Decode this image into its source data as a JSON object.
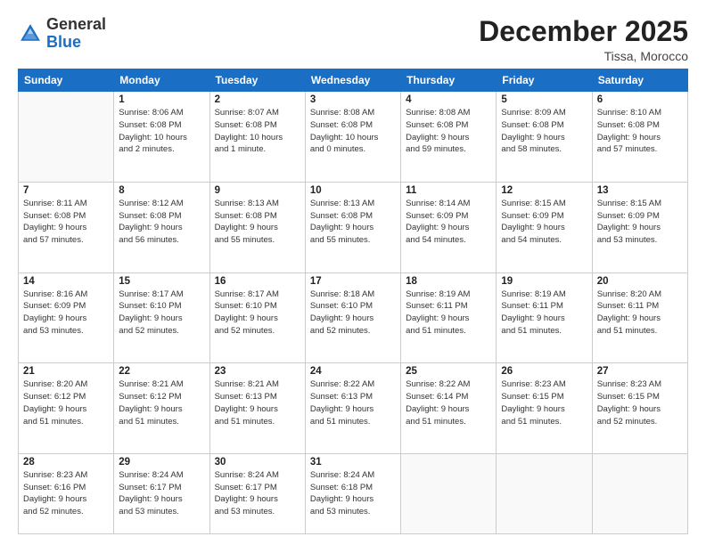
{
  "logo": {
    "general": "General",
    "blue": "Blue"
  },
  "header": {
    "title": "December 2025",
    "subtitle": "Tissa, Morocco"
  },
  "weekdays": [
    "Sunday",
    "Monday",
    "Tuesday",
    "Wednesday",
    "Thursday",
    "Friday",
    "Saturday"
  ],
  "weeks": [
    [
      {
        "day": "",
        "info": ""
      },
      {
        "day": "1",
        "info": "Sunrise: 8:06 AM\nSunset: 6:08 PM\nDaylight: 10 hours\nand 2 minutes."
      },
      {
        "day": "2",
        "info": "Sunrise: 8:07 AM\nSunset: 6:08 PM\nDaylight: 10 hours\nand 1 minute."
      },
      {
        "day": "3",
        "info": "Sunrise: 8:08 AM\nSunset: 6:08 PM\nDaylight: 10 hours\nand 0 minutes."
      },
      {
        "day": "4",
        "info": "Sunrise: 8:08 AM\nSunset: 6:08 PM\nDaylight: 9 hours\nand 59 minutes."
      },
      {
        "day": "5",
        "info": "Sunrise: 8:09 AM\nSunset: 6:08 PM\nDaylight: 9 hours\nand 58 minutes."
      },
      {
        "day": "6",
        "info": "Sunrise: 8:10 AM\nSunset: 6:08 PM\nDaylight: 9 hours\nand 57 minutes."
      }
    ],
    [
      {
        "day": "7",
        "info": "Sunrise: 8:11 AM\nSunset: 6:08 PM\nDaylight: 9 hours\nand 57 minutes."
      },
      {
        "day": "8",
        "info": "Sunrise: 8:12 AM\nSunset: 6:08 PM\nDaylight: 9 hours\nand 56 minutes."
      },
      {
        "day": "9",
        "info": "Sunrise: 8:13 AM\nSunset: 6:08 PM\nDaylight: 9 hours\nand 55 minutes."
      },
      {
        "day": "10",
        "info": "Sunrise: 8:13 AM\nSunset: 6:08 PM\nDaylight: 9 hours\nand 55 minutes."
      },
      {
        "day": "11",
        "info": "Sunrise: 8:14 AM\nSunset: 6:09 PM\nDaylight: 9 hours\nand 54 minutes."
      },
      {
        "day": "12",
        "info": "Sunrise: 8:15 AM\nSunset: 6:09 PM\nDaylight: 9 hours\nand 54 minutes."
      },
      {
        "day": "13",
        "info": "Sunrise: 8:15 AM\nSunset: 6:09 PM\nDaylight: 9 hours\nand 53 minutes."
      }
    ],
    [
      {
        "day": "14",
        "info": "Sunrise: 8:16 AM\nSunset: 6:09 PM\nDaylight: 9 hours\nand 53 minutes."
      },
      {
        "day": "15",
        "info": "Sunrise: 8:17 AM\nSunset: 6:10 PM\nDaylight: 9 hours\nand 52 minutes."
      },
      {
        "day": "16",
        "info": "Sunrise: 8:17 AM\nSunset: 6:10 PM\nDaylight: 9 hours\nand 52 minutes."
      },
      {
        "day": "17",
        "info": "Sunrise: 8:18 AM\nSunset: 6:10 PM\nDaylight: 9 hours\nand 52 minutes."
      },
      {
        "day": "18",
        "info": "Sunrise: 8:19 AM\nSunset: 6:11 PM\nDaylight: 9 hours\nand 51 minutes."
      },
      {
        "day": "19",
        "info": "Sunrise: 8:19 AM\nSunset: 6:11 PM\nDaylight: 9 hours\nand 51 minutes."
      },
      {
        "day": "20",
        "info": "Sunrise: 8:20 AM\nSunset: 6:11 PM\nDaylight: 9 hours\nand 51 minutes."
      }
    ],
    [
      {
        "day": "21",
        "info": "Sunrise: 8:20 AM\nSunset: 6:12 PM\nDaylight: 9 hours\nand 51 minutes."
      },
      {
        "day": "22",
        "info": "Sunrise: 8:21 AM\nSunset: 6:12 PM\nDaylight: 9 hours\nand 51 minutes."
      },
      {
        "day": "23",
        "info": "Sunrise: 8:21 AM\nSunset: 6:13 PM\nDaylight: 9 hours\nand 51 minutes."
      },
      {
        "day": "24",
        "info": "Sunrise: 8:22 AM\nSunset: 6:13 PM\nDaylight: 9 hours\nand 51 minutes."
      },
      {
        "day": "25",
        "info": "Sunrise: 8:22 AM\nSunset: 6:14 PM\nDaylight: 9 hours\nand 51 minutes."
      },
      {
        "day": "26",
        "info": "Sunrise: 8:23 AM\nSunset: 6:15 PM\nDaylight: 9 hours\nand 51 minutes."
      },
      {
        "day": "27",
        "info": "Sunrise: 8:23 AM\nSunset: 6:15 PM\nDaylight: 9 hours\nand 52 minutes."
      }
    ],
    [
      {
        "day": "28",
        "info": "Sunrise: 8:23 AM\nSunset: 6:16 PM\nDaylight: 9 hours\nand 52 minutes."
      },
      {
        "day": "29",
        "info": "Sunrise: 8:24 AM\nSunset: 6:17 PM\nDaylight: 9 hours\nand 53 minutes."
      },
      {
        "day": "30",
        "info": "Sunrise: 8:24 AM\nSunset: 6:17 PM\nDaylight: 9 hours\nand 53 minutes."
      },
      {
        "day": "31",
        "info": "Sunrise: 8:24 AM\nSunset: 6:18 PM\nDaylight: 9 hours\nand 53 minutes."
      },
      {
        "day": "",
        "info": ""
      },
      {
        "day": "",
        "info": ""
      },
      {
        "day": "",
        "info": ""
      }
    ]
  ]
}
